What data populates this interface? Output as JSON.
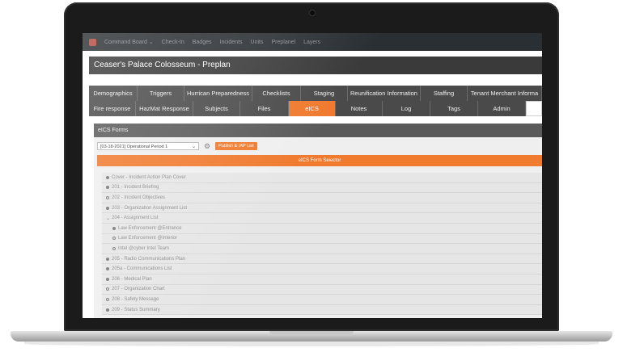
{
  "nav": {
    "items": [
      "Command Board ⌄",
      "Check-In",
      "Badges",
      "Incidents",
      "Units",
      "Preplanel",
      "Layers"
    ]
  },
  "page_title": "Ceaser's Palace Colosseum - Preplan",
  "tabs_row1": [
    "Demographics",
    "Triggers",
    "Hurrican Preparedness",
    "Checklists",
    "Staging",
    "Reunification Information",
    "Staffing",
    "Tenant Merchant Informa"
  ],
  "tabs_row2": [
    "Fire response",
    "HazMat Response",
    "Subjects",
    "Files",
    "eICS",
    "Notes",
    "Log",
    "Tags",
    "Admin"
  ],
  "active_tab": "eICS",
  "panel": {
    "title": "eICS Forms",
    "period": "[03-18-2021] Operational Period 1",
    "publish_label": "Publish & IAP List",
    "form_selector_label": "eICS Form Selector"
  },
  "forms": [
    {
      "label": "Cover - Incident Action Plan Cover",
      "marker": "filled",
      "child": false
    },
    {
      "label": "201 - Incident Briefing",
      "marker": "filled",
      "child": false
    },
    {
      "label": "202 - Incident Objectives",
      "marker": "open",
      "child": false
    },
    {
      "label": "203 - Organization Assignment List",
      "marker": "filled",
      "child": false
    },
    {
      "label": "204 - Assignment List",
      "marker": "caret",
      "child": false
    },
    {
      "label": "Law Enforcement @Entrance",
      "marker": "filled",
      "child": true
    },
    {
      "label": "Law Enforcement @Interior",
      "marker": "open",
      "child": true
    },
    {
      "label": "Intel @cyber Intel Team",
      "marker": "open",
      "child": true
    },
    {
      "label": "205 - Radio Communications Plan",
      "marker": "filled",
      "child": false
    },
    {
      "label": "205a - Communications List",
      "marker": "filled",
      "child": false
    },
    {
      "label": "206 - Medical Plan",
      "marker": "filled",
      "child": false
    },
    {
      "label": "207 - Organization Chart",
      "marker": "open",
      "child": false
    },
    {
      "label": "208 - Safety Message",
      "marker": "open",
      "child": false
    },
    {
      "label": "209 - Status Summary",
      "marker": "filled",
      "child": false
    }
  ]
}
